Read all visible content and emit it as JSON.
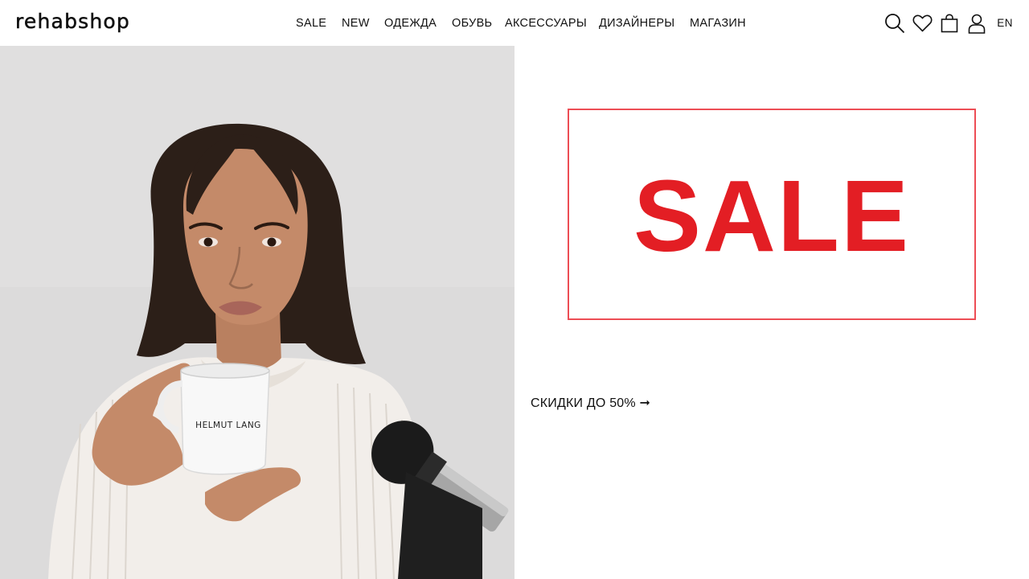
{
  "header": {
    "logo": "rehabshop",
    "nav": [
      {
        "label": "SALE"
      },
      {
        "label": "NEW"
      },
      {
        "label": "ОДЕЖДА"
      },
      {
        "label": "ОБУВЬ"
      },
      {
        "label": "АКСЕССУАРЫ"
      },
      {
        "label": "ДИЗАЙНЕРЫ"
      },
      {
        "label": "МАГАЗИН"
      }
    ],
    "icons": [
      "search-icon",
      "heart-icon",
      "bag-icon",
      "user-icon"
    ],
    "language": "EN"
  },
  "hero": {
    "mug_text": "HELMUT LANG"
  },
  "promo": {
    "banner_text": "SALE",
    "link_text": "СКИДКИ ДО 50% ➞"
  },
  "colors": {
    "accent_red": "#e31e24",
    "border_red": "#ed4d55",
    "text": "#111111",
    "hero_background": "#dedede"
  }
}
